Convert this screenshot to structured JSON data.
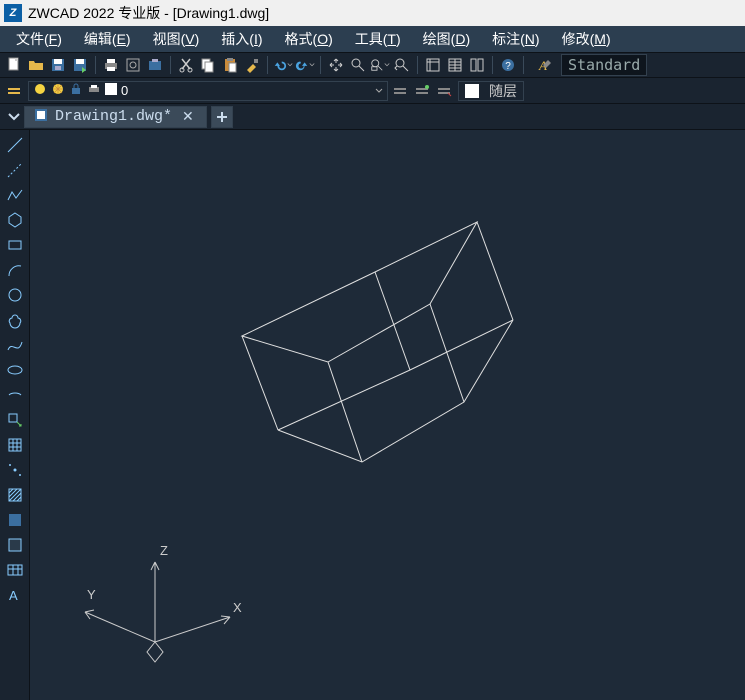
{
  "title": "ZWCAD 2022 专业版 - [Drawing1.dwg]",
  "menus": [
    {
      "label": "文件",
      "key": "F"
    },
    {
      "label": "编辑",
      "key": "E"
    },
    {
      "label": "视图",
      "key": "V"
    },
    {
      "label": "插入",
      "key": "I"
    },
    {
      "label": "格式",
      "key": "O"
    },
    {
      "label": "工具",
      "key": "T"
    },
    {
      "label": "绘图",
      "key": "D"
    },
    {
      "label": "标注",
      "key": "N"
    },
    {
      "label": "修改",
      "key": "M"
    }
  ],
  "style_field": "Standard",
  "layer": {
    "name": "0"
  },
  "linetype_label": "随层",
  "tab": {
    "filename": "Drawing1.dwg*"
  },
  "axes": {
    "x": "X",
    "y": "Y",
    "z": "Z"
  }
}
